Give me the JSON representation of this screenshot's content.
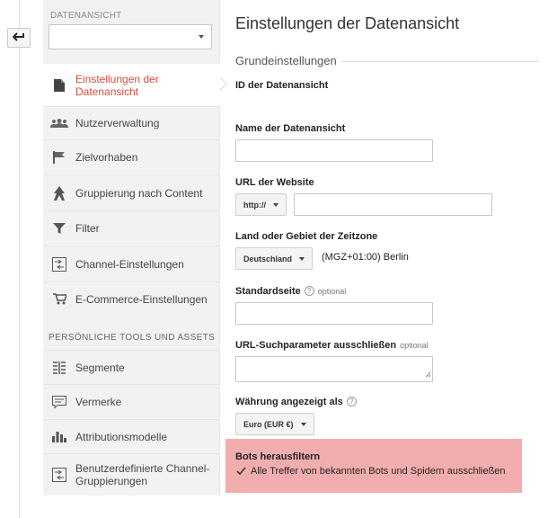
{
  "sidebar": {
    "view_label": "DATENANSICHT",
    "view_select_value": "",
    "items": [
      {
        "label": "Einstellungen der Datenansicht",
        "icon": "document-icon"
      },
      {
        "label": "Nutzerverwaltung",
        "icon": "users-icon"
      },
      {
        "label": "Zielvorhaben",
        "icon": "flag-icon"
      },
      {
        "label": "Gruppierung nach Content",
        "icon": "person-walking-icon"
      },
      {
        "label": "Filter",
        "icon": "filter-icon"
      },
      {
        "label": "Channel-Einstellungen",
        "icon": "channel-settings-icon"
      },
      {
        "label": "E-Commerce-Einstellungen",
        "icon": "cart-icon"
      }
    ],
    "tools_section_label": "PERSÖNLICHE TOOLS UND ASSETS",
    "tools": [
      {
        "label": "Segmente",
        "icon": "segments-icon"
      },
      {
        "label": "Vermerke",
        "icon": "comment-icon"
      },
      {
        "label": "Attributionsmodelle",
        "icon": "bar-chart-icon"
      },
      {
        "label": "Benutzerdefinierte Channel-Gruppierungen",
        "icon": "custom-channel-icon"
      }
    ]
  },
  "main": {
    "title": "Einstellungen der Datenansicht",
    "section_title": "Grundeinstellungen",
    "view_id_label": "ID der Datenansicht",
    "name_label": "Name der Datenansicht",
    "name_value": "",
    "url_label": "URL der Website",
    "url_protocol": "http://",
    "url_value": "",
    "country_label": "Land oder Gebiet der Zeitzone",
    "country_value": "Deutschland",
    "timezone_text": "(MGZ+01:00) Berlin",
    "default_page_label": "Standardseite",
    "optional": "optional",
    "default_page_value": "",
    "url_exclude_label": "URL-Suchparameter ausschließen",
    "url_exclude_value": "",
    "currency_label": "Währung angezeigt als",
    "currency_value": "Euro (EUR €)",
    "help_glyph": "?"
  },
  "bots": {
    "title": "Bots herausfiltern",
    "checkbox_label": "Alle Treffer von bekannten Bots und Spidern ausschließen",
    "checked": true
  },
  "colors": {
    "active_red": "#dd4b39",
    "highlight": "#f2aeae",
    "sidebar_bg": "#f2f2f2"
  }
}
